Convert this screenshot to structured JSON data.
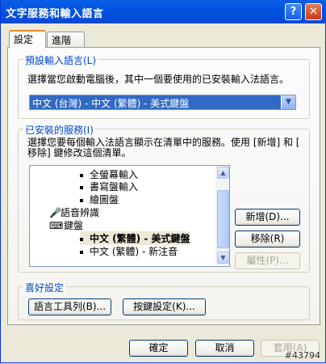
{
  "window": {
    "title": "文字服務和輸入語言",
    "help_label": "?",
    "close_label": "✕"
  },
  "tabs": [
    {
      "label": "設定"
    },
    {
      "label": "進階"
    }
  ],
  "default_lang": {
    "legend": "預設輸入語言(L)",
    "description": "選擇當您啟動電腦後，其中一個要使用的已安裝輸入法語言。",
    "selected": "中文 (台灣) - 中文 (繁體) - 美式鍵盤"
  },
  "installed": {
    "legend": "已安裝的服務(I)",
    "description_line1": "選擇您要每個輸入法語言顯示在清單中的服務。使用 [新增] 和 [",
    "description_line2": "移除] 鍵修改這個清單。",
    "items": [
      {
        "label": "全螢幕輸入"
      },
      {
        "label": "書寫盤輸入"
      },
      {
        "label": "繪圖盤"
      },
      {
        "label": "語音辨識"
      },
      {
        "label": "鍵盤"
      },
      {
        "label": "中文 (繁體) - 美式鍵盤"
      },
      {
        "label": "中文 (繁體) - 新注音"
      }
    ],
    "add_label": "新增(D)...",
    "remove_label": "移除(R)",
    "props_label": "屬性(P)..."
  },
  "prefs": {
    "legend": "喜好設定",
    "langbar_label": "語言工具列(B)...",
    "keys_label": "按鍵設定(K)..."
  },
  "footer": {
    "ok_label": "確定",
    "cancel_label": "取消",
    "apply_label": "套用(A)"
  },
  "watermark": "#43794"
}
